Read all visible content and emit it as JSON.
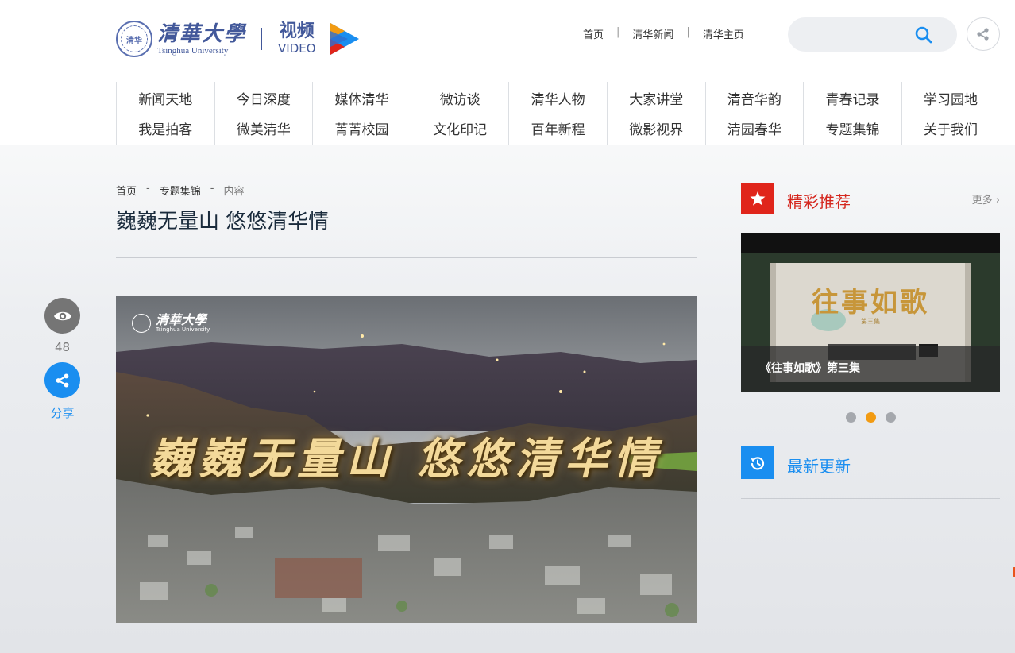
{
  "logo": {
    "seal_text": "清华",
    "name_cn": "清華大學",
    "name_en": "Tsinghua University",
    "video_cn": "视频",
    "video_en": "VIDEO"
  },
  "topnav": {
    "home": "首页",
    "news": "清华新闻",
    "homepage": "清华主页",
    "separator": "|"
  },
  "search": {
    "placeholder": "",
    "icon": "search-icon"
  },
  "mainnav": {
    "columns": [
      [
        "新闻天地",
        "我是拍客"
      ],
      [
        "今日深度",
        "微美清华"
      ],
      [
        "媒体清华",
        "菁菁校园"
      ],
      [
        "微访谈",
        "文化印记"
      ],
      [
        "清华人物",
        "百年新程"
      ],
      [
        "大家讲堂",
        "微影视界"
      ],
      [
        "清音华韵",
        "清园春华"
      ],
      [
        "青春记录",
        "专题集锦"
      ],
      [
        "学习园地",
        "关于我们"
      ]
    ]
  },
  "breadcrumb": {
    "home": "首页",
    "section": "专题集锦",
    "current": "内容",
    "separator": "-"
  },
  "article": {
    "title": "巍巍无量山 悠悠清华情",
    "views": "48",
    "share_label": "分享"
  },
  "video": {
    "logo_cn": "清華大學",
    "logo_en": "Tsinghua University",
    "overlay_title": "巍巍无量山 悠悠清华情"
  },
  "sidebar": {
    "recommend_title": "精彩推荐",
    "more": "更多 ›",
    "card_caption": "《往事如歌》第三集",
    "card_art_title": "往事如歌",
    "card_art_sub": "第三集",
    "slides": 3,
    "active_slide": 2,
    "latest_title": "最新更新"
  },
  "colors": {
    "brand_blue": "#42589a",
    "accent_blue": "#1a8ef0",
    "accent_red": "#e0251b",
    "active_dot": "#f29b12"
  }
}
